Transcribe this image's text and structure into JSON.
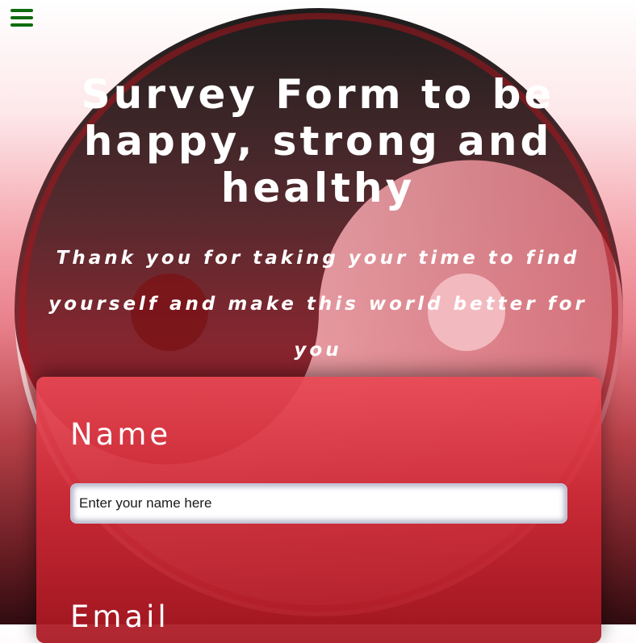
{
  "nav": {
    "menu_icon": "hamburger-menu-icon"
  },
  "header": {
    "title": "Survey Form to be happy, strong and healthy",
    "subtitle": "Thank you for taking your time to find yourself and make this world better for you"
  },
  "form": {
    "name": {
      "label": "Name",
      "placeholder": "Enter your name here",
      "value": ""
    },
    "email": {
      "label": "Email"
    }
  },
  "colors": {
    "menu_icon": "#0e6b0e",
    "text": "#ffffff",
    "card": "#d8323e",
    "yin_dark": "#1c1c1c",
    "yin_light": "#f6d4d8"
  }
}
